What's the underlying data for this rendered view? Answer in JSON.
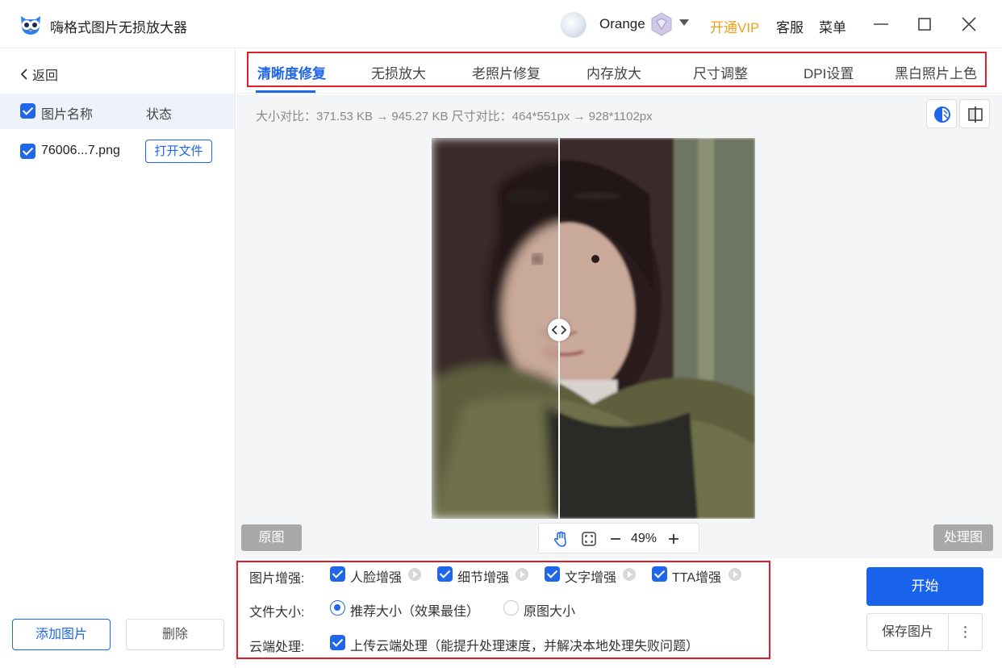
{
  "app": {
    "title": "嗨格式图片无损放大器",
    "user_name": "Orange",
    "vip_link": "开通VIP",
    "service": "客服",
    "menu": "菜单"
  },
  "sidebar": {
    "back": "返回",
    "header": {
      "name": "图片名称",
      "status": "状态"
    },
    "files": [
      {
        "name": "76006...7.png",
        "action": "打开文件"
      }
    ],
    "add_button": "添加图片",
    "delete_button": "删除"
  },
  "tabs": [
    {
      "label": "清晰度修复",
      "active": true
    },
    {
      "label": "无损放大",
      "active": false
    },
    {
      "label": "老照片修复",
      "active": false
    },
    {
      "label": "内存放大",
      "active": false
    },
    {
      "label": "尺寸调整",
      "active": false
    },
    {
      "label": "DPI设置",
      "active": false
    },
    {
      "label": "黑白照片上色",
      "active": false
    }
  ],
  "preview": {
    "size_info": "大小对比：371.53 KB → 945.27 KB   尺寸对比：464*551px → 928*1102px",
    "original_label": "原图",
    "processed_label": "处理图",
    "zoom": "49%"
  },
  "options": {
    "enhance": {
      "label": "图片增强:",
      "items": [
        "人脸增强",
        "细节增强",
        "文字增强",
        "TTA增强"
      ]
    },
    "file_size": {
      "label": "文件大小:",
      "choices": [
        "推荐大小（效果最佳）",
        "原图大小"
      ],
      "selected": "推荐大小（效果最佳）"
    },
    "cloud": {
      "label": "云端处理:",
      "item": "上传云端处理（能提升处理速度，并解决本地处理失败问题）"
    }
  },
  "actions": {
    "start": "开始",
    "save": "保存图片",
    "more": "⋮"
  },
  "colors": {
    "accent": "#1f66ea",
    "vip": "#f0a020",
    "highlight_frame": "#e01e2b"
  }
}
